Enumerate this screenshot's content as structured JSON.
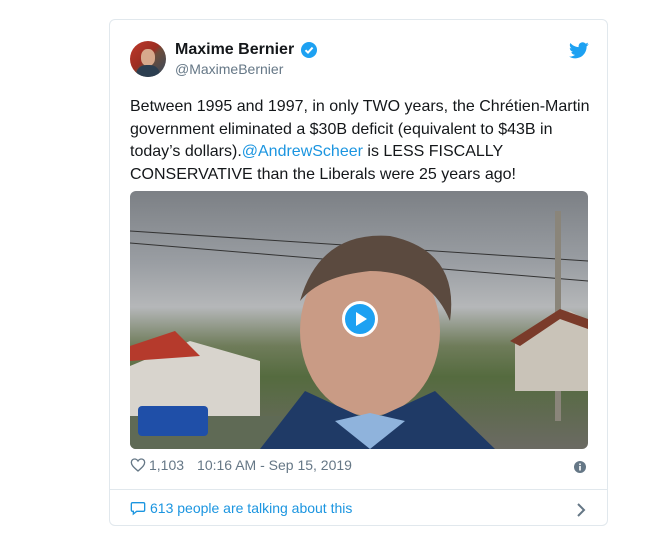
{
  "tweet": {
    "author_name": "Maxime Bernier",
    "handle": "@MaximeBernier",
    "text_before": "Between 1995 and 1997, in only TWO years, the Chrétien-Martin government eliminated a $30B deficit (equivalent to $43B in today’s dollars).",
    "mention": "@AndrewScheer",
    "text_after": " is LESS FISCALLY CONSERVATIVE than the Liberals were 25 years ago!",
    "likes": "1,103",
    "timestamp": "10:16 AM - Sep 15, 2019",
    "talking": "613 people are talking about this"
  },
  "colors": {
    "accent": "#1da1f2",
    "link": "#1b95e0",
    "muted": "#657786"
  },
  "icons": [
    "verified-icon",
    "twitter-bird-icon",
    "play-icon",
    "heart-icon",
    "info-icon",
    "reply-bubble-icon",
    "chevron-right-icon"
  ]
}
